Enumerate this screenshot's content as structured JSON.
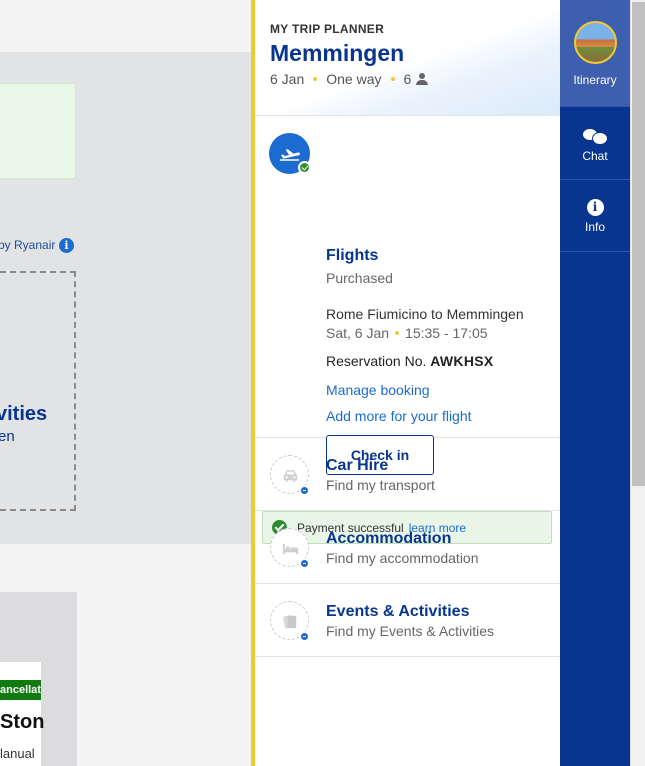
{
  "background": {
    "ryanair_text": "by Ryanair",
    "info_glyph": "i",
    "activities_heading": "vities",
    "activities_sub": "en",
    "cancellation_badge": "ancellati",
    "card_title": "Ston",
    "card_text": "lanual"
  },
  "planner": {
    "label": "MY TRIP PLANNER",
    "destination": "Memmingen",
    "date": "6 Jan",
    "trip_type": "One way",
    "passengers": "6",
    "flights": {
      "title": "Flights",
      "status": "Purchased",
      "route": "Rome Fiumicino to Memmingen",
      "day_date": "Sat, 6 Jan",
      "time": "15:35 - 17:05",
      "reservation_label": "Reservation No.",
      "reservation_number": "AWKHSX",
      "manage_booking": "Manage booking",
      "add_more": "Add more for your flight",
      "check_in": "Check in",
      "payment_text": "Payment successful",
      "payment_link": "learn more"
    },
    "car_hire": {
      "title": "Car Hire",
      "sub": "Find my transport"
    },
    "accommodation": {
      "title": "Accommodation",
      "sub": "Find my accommodation"
    },
    "events": {
      "title": "Events & Activities",
      "sub": "Find my Events & Activities"
    }
  },
  "nav": {
    "itinerary": "Itinerary",
    "chat": "Chat",
    "info": "Info",
    "info_glyph": "i"
  },
  "icons": {
    "flight": "plane-departure-icon",
    "car": "car-icon",
    "bed": "bed-icon",
    "events": "ticket-icon",
    "chat": "chat-bubbles-icon",
    "info": "info-icon",
    "person": "person-icon"
  },
  "colors": {
    "brand_blue": "#073590",
    "accent_yellow": "#f1c933",
    "link_blue": "#1b6bd1",
    "success_green": "#2e8b2e"
  }
}
